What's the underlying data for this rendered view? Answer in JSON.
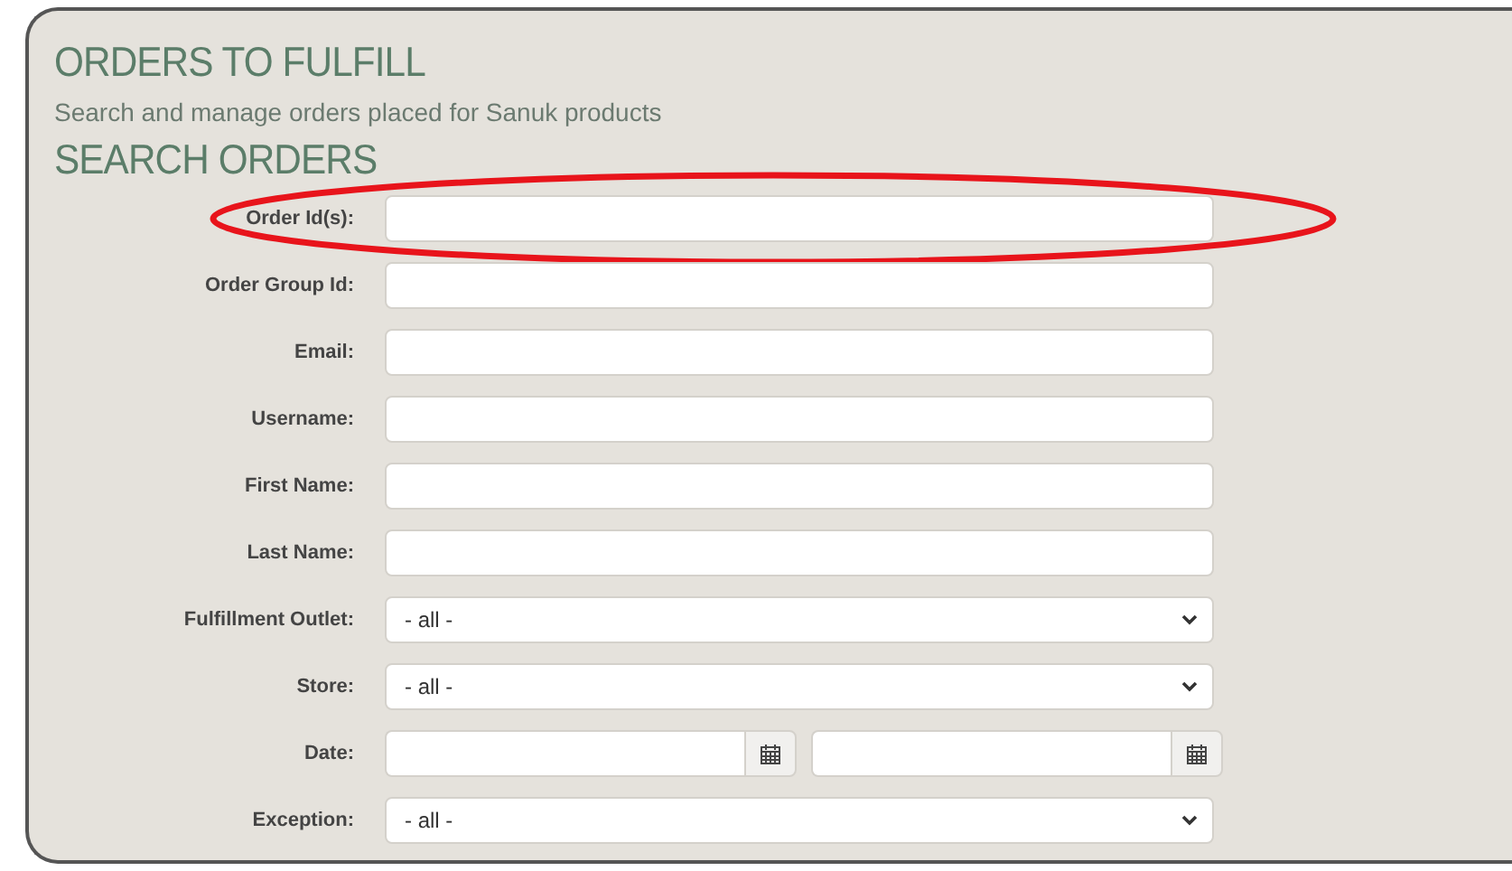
{
  "title": "ORDERS TO FULFILL",
  "subtitle": "Search and manage orders placed for Sanuk products",
  "section_title": "SEARCH ORDERS",
  "fields": [
    {
      "kind": "text",
      "label": "Order Id(s):",
      "highlighted": true
    },
    {
      "kind": "text",
      "label": "Order Group Id:",
      "highlighted": false
    },
    {
      "kind": "text",
      "label": "Email:",
      "highlighted": false
    },
    {
      "kind": "text",
      "label": "Username:",
      "highlighted": false
    },
    {
      "kind": "text",
      "label": "First Name:",
      "highlighted": false
    },
    {
      "kind": "text",
      "label": "Last Name:",
      "highlighted": false
    },
    {
      "kind": "select",
      "label": "Fulfillment Outlet:",
      "value": "- all -",
      "highlighted": false
    },
    {
      "kind": "select",
      "label": "Store:",
      "value": "- all -",
      "highlighted": false
    },
    {
      "kind": "daterange",
      "label": "Date:",
      "highlighted": false
    },
    {
      "kind": "select",
      "label": "Exception:",
      "value": "- all -",
      "highlighted": false
    }
  ]
}
